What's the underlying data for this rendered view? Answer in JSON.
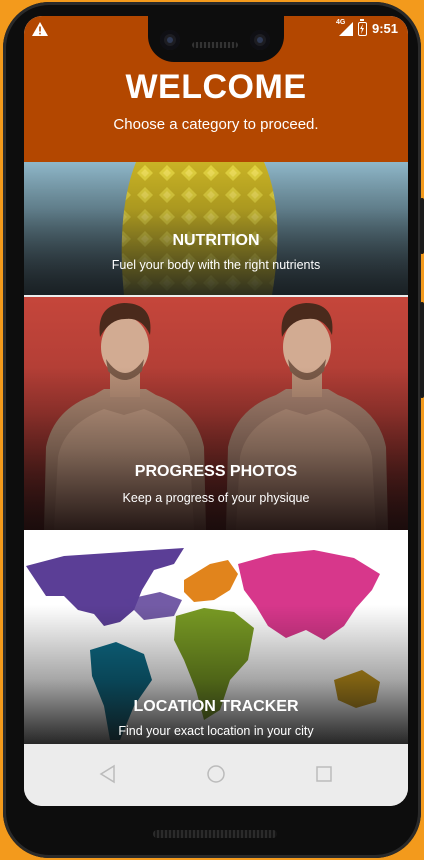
{
  "status_bar": {
    "warning_icon": "warning-triangle-icon",
    "network": "4G",
    "time": "9:51"
  },
  "header": {
    "title": "WELCOME",
    "subtitle": "Choose a category to proceed."
  },
  "categories": [
    {
      "title": "NUTRITION",
      "description": "Fuel your body with the right nutrients",
      "icon": "pineapple-image"
    },
    {
      "title": "PROGRESS PHOTOS",
      "description": "Keep a progress of your physique",
      "icon": "physique-image"
    },
    {
      "title": "LOCATION TRACKER",
      "description": "Find your exact location in your city",
      "icon": "world-map-image"
    }
  ],
  "nav_bar": {
    "back": "back-icon",
    "home": "home-icon",
    "recents": "recents-icon"
  },
  "colors": {
    "header_bg": "#b34700",
    "frame": "#f39a1c"
  }
}
